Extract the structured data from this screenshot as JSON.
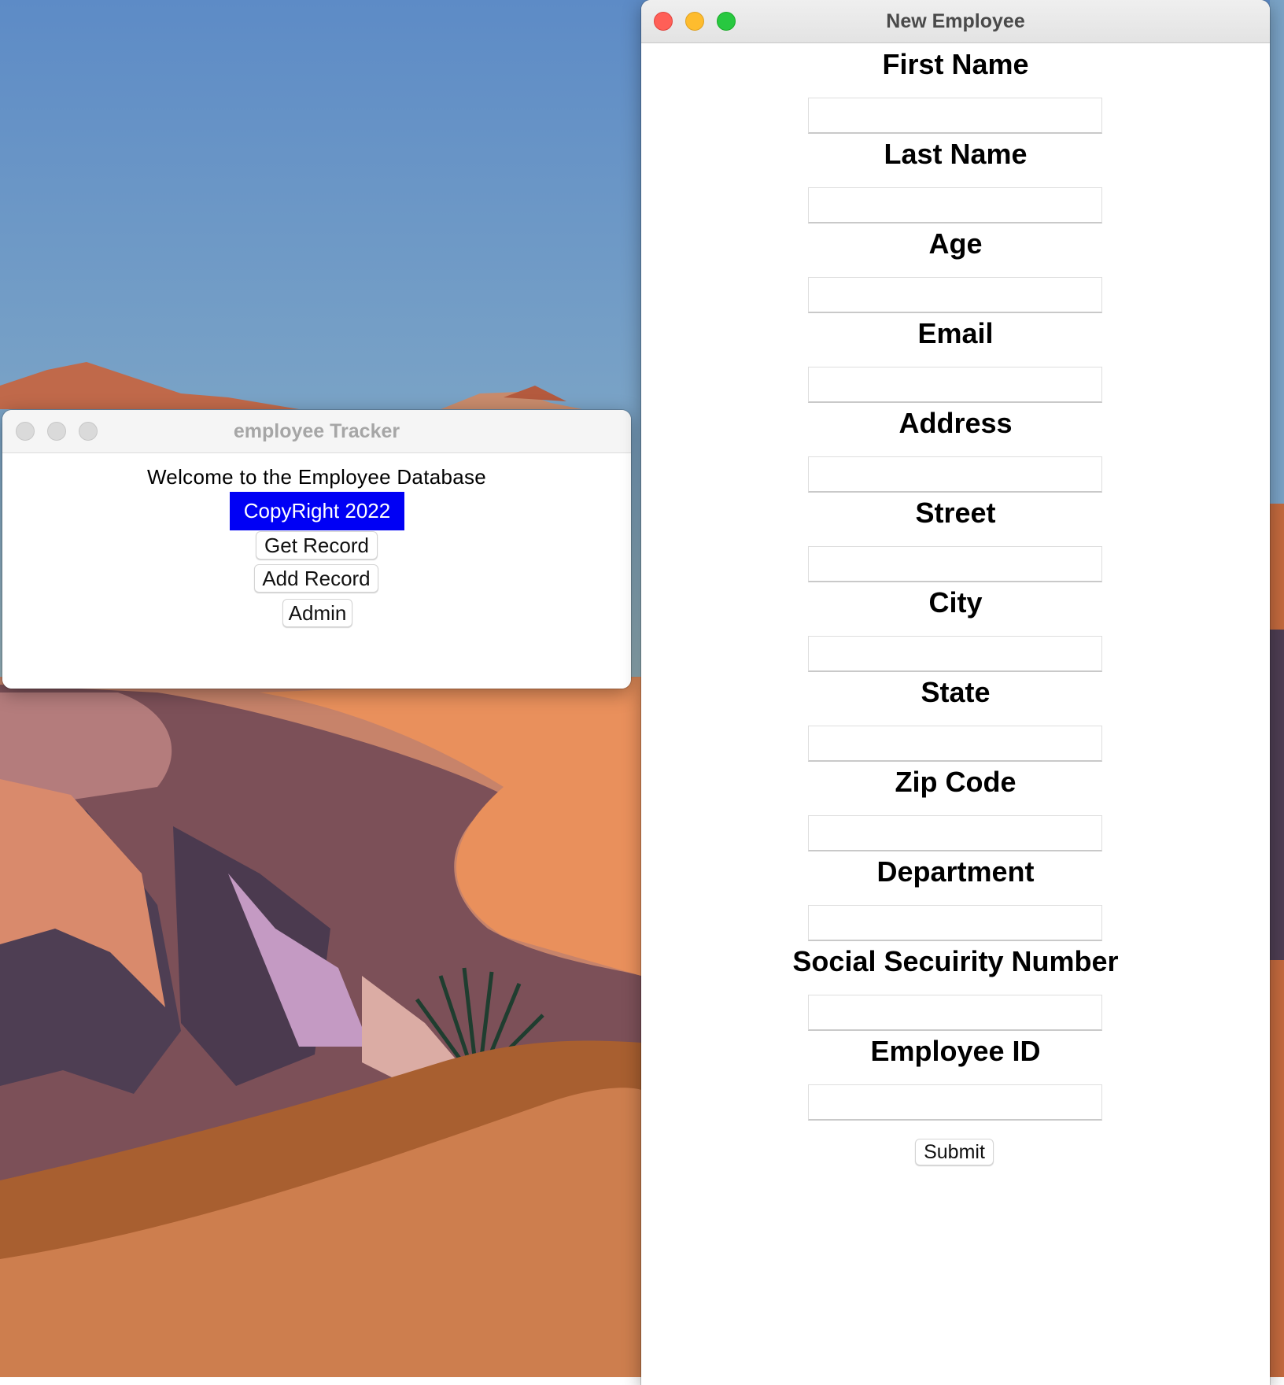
{
  "tracker_window": {
    "title": "employee Tracker",
    "welcome": "Welcome to the Employee Database",
    "copyright": "CopyRight 2022",
    "buttons": {
      "get_record": "Get Record",
      "add_record": "Add Record",
      "admin": "Admin"
    }
  },
  "new_employee_window": {
    "title": "New Employee",
    "fields": [
      {
        "label": "First Name",
        "value": ""
      },
      {
        "label": "Last Name",
        "value": ""
      },
      {
        "label": "Age",
        "value": ""
      },
      {
        "label": "Email",
        "value": ""
      },
      {
        "label": "Address",
        "value": ""
      },
      {
        "label": "Street",
        "value": ""
      },
      {
        "label": "City",
        "value": ""
      },
      {
        "label": "State",
        "value": ""
      },
      {
        "label": "Zip Code",
        "value": ""
      },
      {
        "label": "Department",
        "value": ""
      },
      {
        "label": "Social Secuirity Number",
        "value": ""
      },
      {
        "label": "Employee ID",
        "value": ""
      }
    ],
    "submit": "Submit"
  },
  "colors": {
    "copyright_bg": "#0000f5",
    "close": "#ff5f57",
    "minimize": "#febc2e",
    "zoom": "#28c840"
  }
}
